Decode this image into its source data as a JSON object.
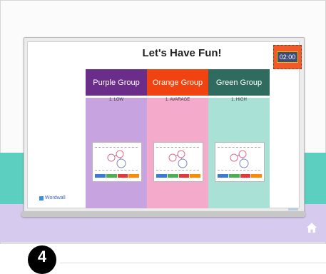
{
  "slide": {
    "title": "Let's Have Fun!",
    "timer": "02:00",
    "logo": "Wordwall"
  },
  "groups": [
    {
      "name": "Purple Group",
      "level": "1.  LOW",
      "head_color": "#6b2d8a",
      "body_color": "#c7a3e0"
    },
    {
      "name": "Orange Group",
      "level": "1.  AVARAGE",
      "head_color": "#f0430f",
      "body_color": "#f3aacb"
    },
    {
      "name": "Green Group",
      "level": "1.  HIGH",
      "head_color": "#2f6b5e",
      "body_color": "#a9e1d6"
    }
  ],
  "thumbnail_tab_colors": [
    "#3a7bd5",
    "#4caf50",
    "#e53935",
    "#fb8c00"
  ],
  "step_number": "4",
  "icons": [
    "home-icon",
    "wordwall-logo-icon"
  ]
}
